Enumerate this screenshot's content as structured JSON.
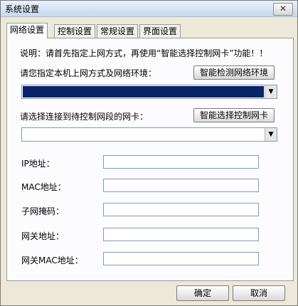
{
  "window": {
    "title": "系统设置",
    "close_glyph": "✕"
  },
  "tabs": [
    {
      "label": "网络设置",
      "active": true
    },
    {
      "label": "控制设置",
      "active": false
    },
    {
      "label": "常规设置",
      "active": false
    },
    {
      "label": "界面设置",
      "active": false
    }
  ],
  "network": {
    "instruction": "说明：请首先指定上网方式，再使用“智能选择控制网卡”功能！！",
    "env_label": "请您指定本机上网方式及网络环境：",
    "detect_button": "智能检测网络环境",
    "card_label": "请选择连接到待控制网段的网卡：",
    "select_card_button": "智能选择控制网卡",
    "fields": {
      "ip_label": "IP地址：",
      "mac_label": "MAC地址：",
      "mask_label": "子网掩码：",
      "gateway_label": "网关地址：",
      "gateway_mac_label": "网关MAC地址："
    }
  },
  "footer": {
    "ok_label": "确定",
    "cancel_label": "取消"
  }
}
